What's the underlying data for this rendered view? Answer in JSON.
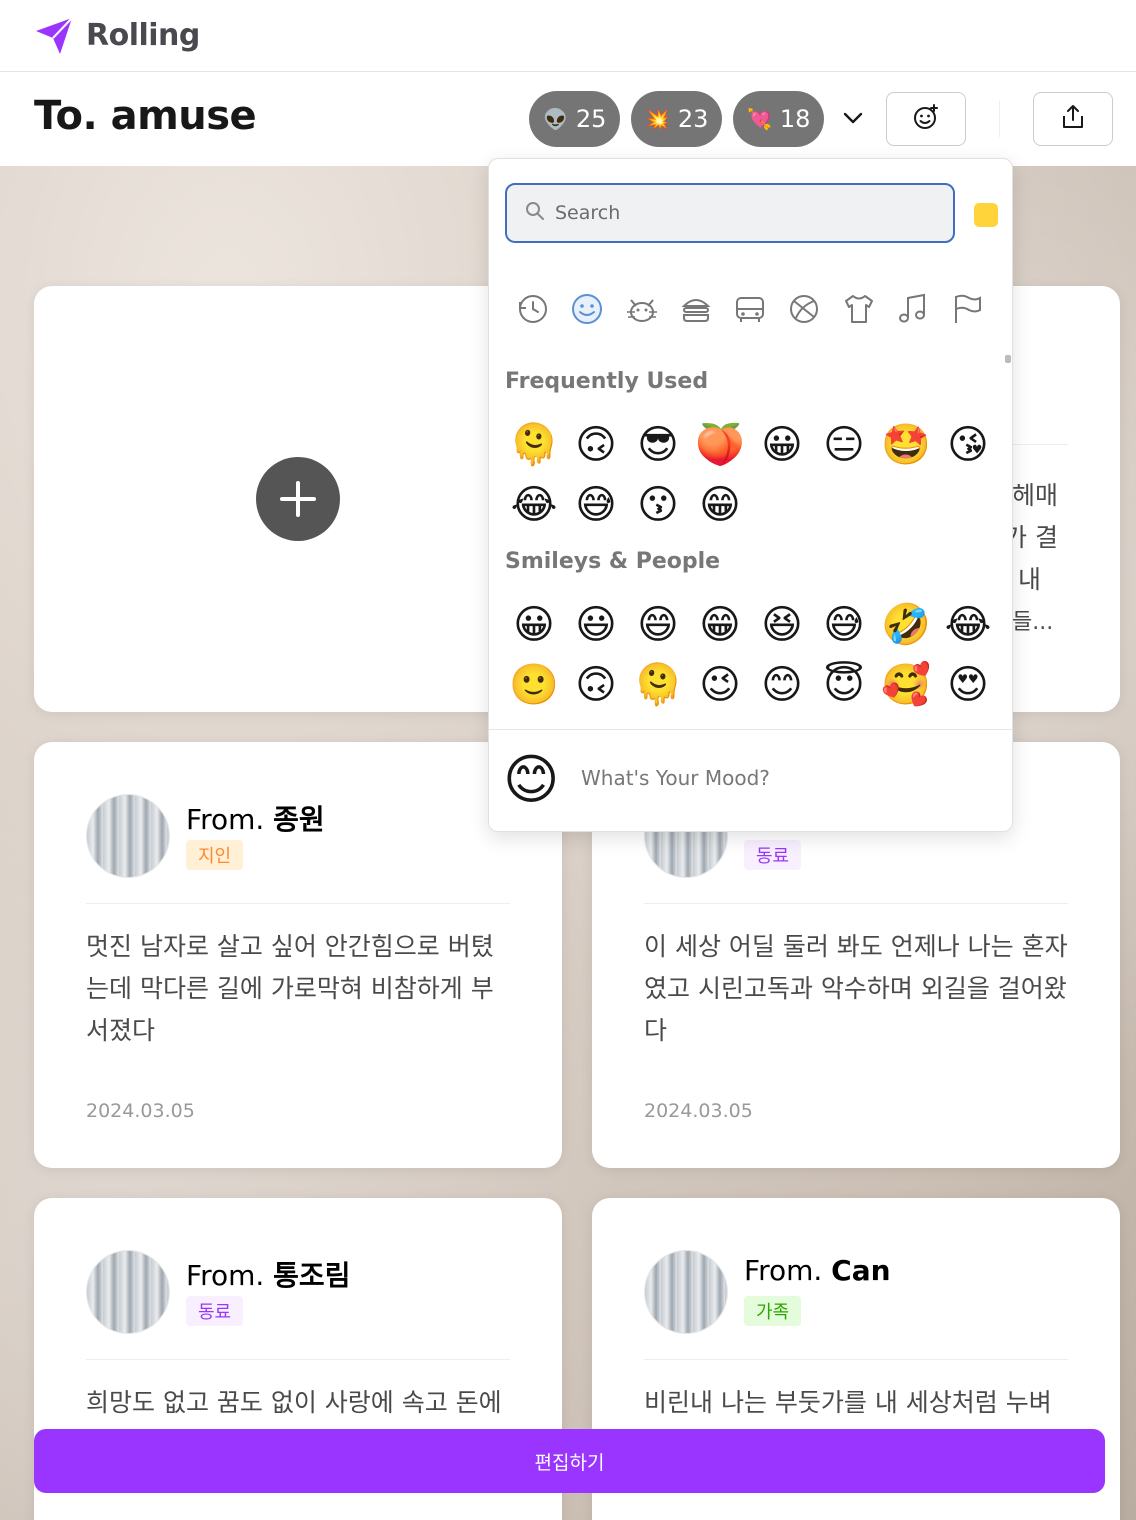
{
  "brand": {
    "name": "Rolling",
    "logo_icon": "paper-plane-icon",
    "color": "#9935ff"
  },
  "header": {
    "recipient": "To. amuse",
    "reactions": [
      {
        "emoji": "👽",
        "count": "25"
      },
      {
        "emoji": "💥",
        "count": "23"
      },
      {
        "emoji": "💘",
        "count": "18"
      }
    ],
    "expand_icon": "chevron-down-icon",
    "add_reaction_icon": "smiley-add-icon",
    "share_icon": "share-icon"
  },
  "picker": {
    "search_placeholder": "Search",
    "categories": [
      "recent-icon",
      "smileys-icon",
      "animals-icon",
      "food-icon",
      "travel-icon",
      "activity-icon",
      "objects-icon",
      "symbols-icon",
      "flags-icon"
    ],
    "sections": [
      {
        "title": "Frequently Used",
        "emojis": [
          "🫠",
          "🙃",
          "😎",
          "🍑",
          "😀",
          "😑",
          "🤩",
          "😘",
          "😂",
          "😅",
          "😗",
          "😁"
        ]
      },
      {
        "title": "Smileys & People",
        "emojis": [
          "😀",
          "😃",
          "😄",
          "😁",
          "😆",
          "😅",
          "🤣",
          "😂",
          "🙂",
          "🙃",
          "🫠",
          "😉",
          "😊",
          "😇",
          "🥰",
          "😍"
        ]
      }
    ],
    "preview_emoji": "😊",
    "preview_text": "What's Your Mood?"
  },
  "peek_text": [
    "헤매",
    "가 결",
    "내",
    "들..."
  ],
  "cards": [
    {
      "from_prefix": "From. ",
      "name": "종원",
      "relation": "지인",
      "relation_type": "friend",
      "message": "멋진 남자로 살고 싶어 안간힘으로 버텼는데 막다른 길에 가로막혀 비참하게 부서졌다",
      "date": "2024.03.05"
    },
    {
      "from_prefix": "",
      "name": "",
      "relation": "동료",
      "relation_type": "coworker",
      "message": "이 세상 어딜 둘러 봐도 언제나 나는 혼자였고 시린고독과 악수하며 외길을 걸어왔다",
      "date": "2024.03.05"
    },
    {
      "from_prefix": "From. ",
      "name": "통조림",
      "relation": "동료",
      "relation_type": "coworker",
      "message": "희망도 없고 꿈도 없이 사랑에 속고 돈에",
      "date": ""
    },
    {
      "from_prefix": "From. ",
      "name": "Can",
      "relation": "가족",
      "relation_type": "family",
      "message": "비린내 나는 부둣가를 내 세상처럼 누벼",
      "date": ""
    }
  ],
  "bottom": {
    "edit_label": "편집하기"
  }
}
